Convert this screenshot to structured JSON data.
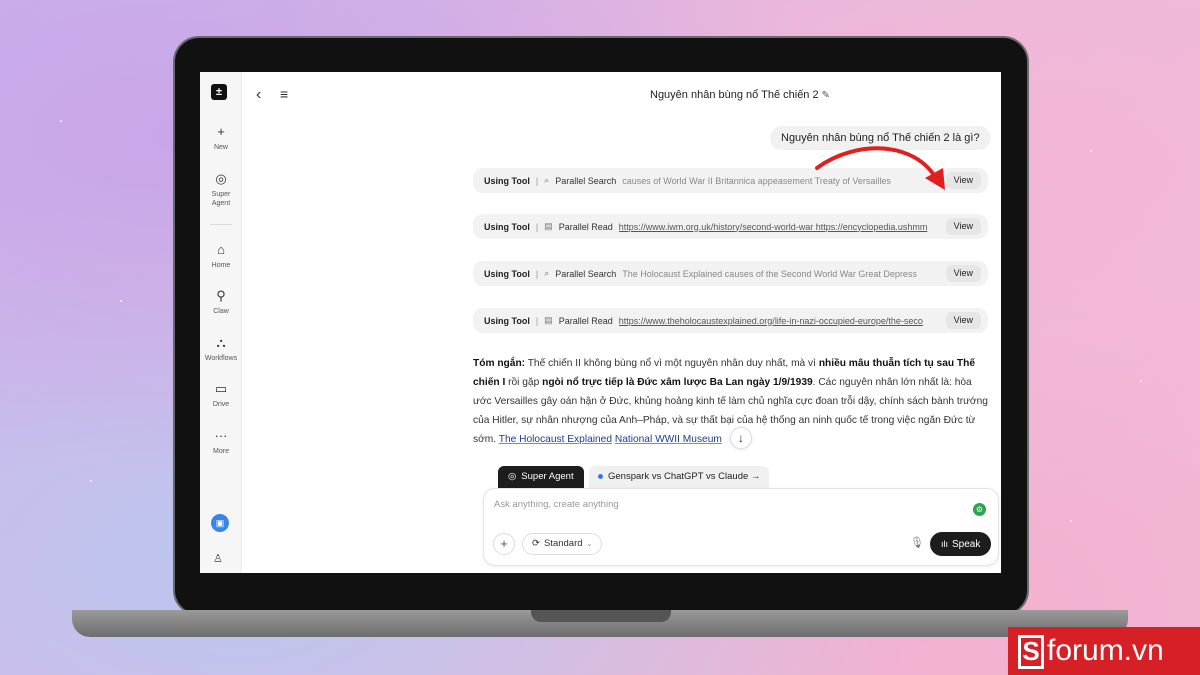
{
  "header": {
    "title": "Nguyên nhân bùng nổ Thế chiến 2"
  },
  "sidebar": {
    "items": [
      {
        "icon": "plus-icon",
        "label": "New"
      },
      {
        "icon": "super-agent-icon",
        "label": "Super Agent"
      },
      {
        "icon": "home-icon",
        "label": "Home"
      },
      {
        "icon": "claw-icon",
        "label": "Claw"
      },
      {
        "icon": "workflows-icon",
        "label": "Workflows"
      },
      {
        "icon": "drive-icon",
        "label": "Drive"
      },
      {
        "icon": "more-icon",
        "label": "More"
      }
    ]
  },
  "chat": {
    "user_message": "Nguyên nhân bùng nổ Thế chiến 2 là gì?",
    "tools": [
      {
        "using": "Using Tool",
        "name": "Parallel Search",
        "detail": "causes of World War II Britannica appeasement Treaty of Versailles",
        "view": "View",
        "kind": "search"
      },
      {
        "using": "Using Tool",
        "name": "Parallel Read",
        "detail": "https://www.iwm.org.uk/history/second-world-war https://encyclopedia.ushmm",
        "view": "View",
        "kind": "read"
      },
      {
        "using": "Using Tool",
        "name": "Parallel Search",
        "detail": "The Holocaust Explained causes of the Second World War Great Depress",
        "view": "View",
        "kind": "search"
      },
      {
        "using": "Using Tool",
        "name": "Parallel Read",
        "detail": "https://www.theholocaustexplained.org/life-in-nazi-occupied-europe/the-seco",
        "view": "View",
        "kind": "read"
      }
    ],
    "answer": {
      "lead": "Tóm ngắn:",
      "p1": " Thế chiến II không bùng nổ vì một nguyên nhân duy nhất, mà vì ",
      "b1": "nhiều mâu thuẫn tích tụ sau Thế chiến I",
      "p2": " rồi gặp ",
      "b2": "ngòi nổ trực tiếp là Đức xâm lược Ba Lan ngày 1/9/1939",
      "p3": ". Các nguyên nhân lớn nhất là: hòa ước Versailles gây oán hận ở Đức, khủng hoảng kinh tế làm chủ nghĩa cực đoan trỗi dậy, chính sách bành trướng của Hitler, sự nhân nhượng của Anh–Pháp, và sự thất bại của hệ thống an ninh quốc tế trong việc ngăn Đức từ sớm.",
      "source1": "The Holocaust Explained",
      "source2": "National WWII Museum"
    }
  },
  "composer": {
    "agent_chip": "Super Agent",
    "compare_chip": "Genspark vs ChatGPT vs Claude →",
    "placeholder": "Ask anything, create anything",
    "mode": "Standard",
    "speak": "Speak"
  },
  "watermark": {
    "text": "forum.vn",
    "letter": "S"
  },
  "colors": {
    "accent_dark": "#1d1d1d",
    "link": "#1a3d8f",
    "watermark_red": "#d71f26",
    "arrow_red": "#e02020"
  }
}
